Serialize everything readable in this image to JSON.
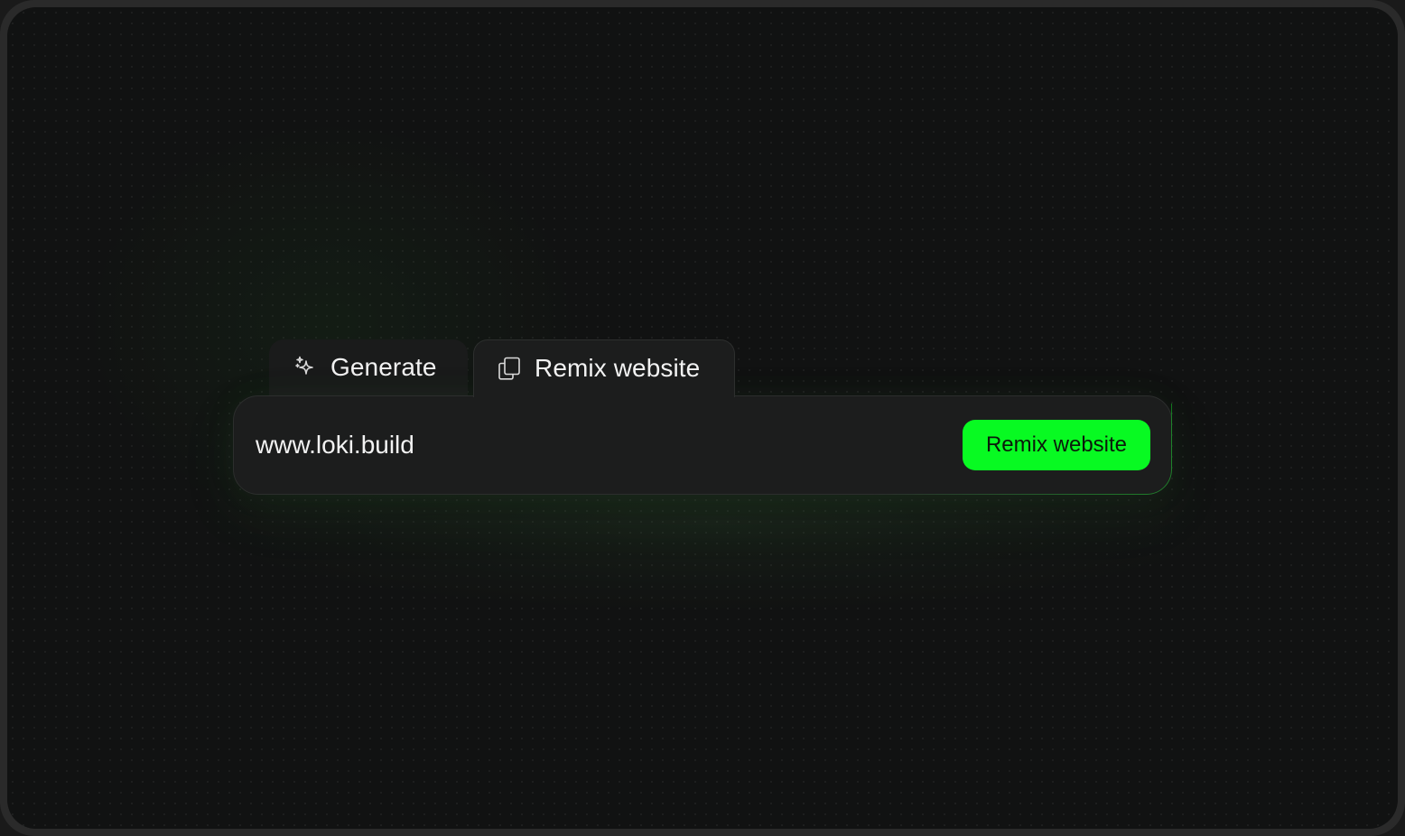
{
  "tabs": [
    {
      "label": "Generate",
      "icon": "sparkles-icon"
    },
    {
      "label": "Remix website",
      "icon": "copy-icon"
    }
  ],
  "active_tab": "Remix website",
  "input": {
    "value": "www.loki.build",
    "placeholder": ""
  },
  "submit_button": {
    "label": "Remix website"
  },
  "colors": {
    "accent": "#08fa22",
    "background": "#111212",
    "panel": "#1c1d1d",
    "text": "#f2f2f2"
  }
}
